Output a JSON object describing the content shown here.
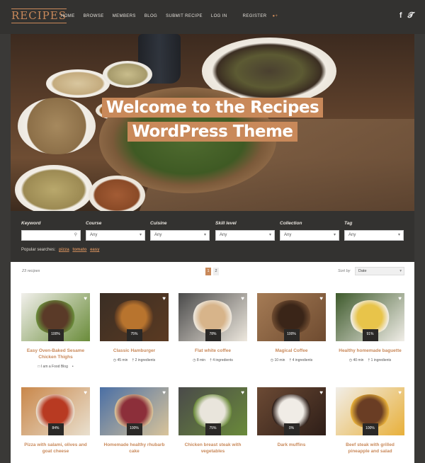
{
  "header": {
    "logo": "RECIPES",
    "nav": [
      "HOME",
      "BROWSE",
      "MEMBERS",
      "BLOG",
      "SUBMIT RECIPE",
      "LOG IN"
    ],
    "register_label": "REGISTER",
    "social": {
      "facebook": "f",
      "twitter": "t"
    }
  },
  "hero": {
    "title_line1": "Welcome to the Recipes",
    "title_line2": "WordPress Theme"
  },
  "search": {
    "fields": [
      {
        "label": "Keyword",
        "value": ""
      },
      {
        "label": "Course",
        "value": "Any"
      },
      {
        "label": "Cuisine",
        "value": "Any"
      },
      {
        "label": "Skill level",
        "value": "Any"
      },
      {
        "label": "Collection",
        "value": "Any"
      },
      {
        "label": "Tag",
        "value": "Any"
      }
    ],
    "popular_label": "Popular searches:",
    "popular": [
      "pizza",
      "tomato",
      "easy"
    ]
  },
  "listing": {
    "count": "23 recipes",
    "pages": [
      "1",
      "2"
    ],
    "sort_label": "Sort by",
    "sort_value": "Date",
    "cards": [
      {
        "title": "Easy Oven-Baked Sesame Chicken Thighs",
        "rating": "100%",
        "meta": [
          "I am a Food Blog"
        ],
        "colors": [
          "#f2f0ec",
          "#5a3a28",
          "#6a8c3a"
        ]
      },
      {
        "title": "Classic Hamburger",
        "rating": "75%",
        "meta": [
          "45 min",
          "2 ingredients"
        ],
        "colors": [
          "#3a2e24",
          "#b8742e",
          "#5b3a22"
        ]
      },
      {
        "title": "Flat white coffee",
        "rating": "78%",
        "meta": [
          "8 min",
          "4 ingredients"
        ],
        "colors": [
          "#4a4a4a",
          "#d7b48a",
          "#eee8de"
        ]
      },
      {
        "title": "Magical Coffee",
        "rating": "100%",
        "meta": [
          "10 min",
          "4 ingredients"
        ],
        "colors": [
          "#a57b55",
          "#3a2518",
          "#6e4b30"
        ]
      },
      {
        "title": "Healthy homemade baguette",
        "rating": "91%",
        "meta": [
          "40 min",
          "1 ingredients"
        ],
        "colors": [
          "#3e5a2c",
          "#e8c44a",
          "#f1eee8"
        ]
      },
      {
        "title": "Pizza with salami, olives and goat cheese",
        "rating": "84%",
        "meta": [],
        "colors": [
          "#c9874a",
          "#b83a22",
          "#e9e0cf"
        ]
      },
      {
        "title": "Homemade healthy rhubarb cake",
        "rating": "100%",
        "meta": [],
        "colors": [
          "#4a6fa5",
          "#8c2f3a",
          "#d9c49a"
        ]
      },
      {
        "title": "Chicken breast steak with vegetables",
        "rating": "75%",
        "meta": [],
        "colors": [
          "#4a4a4a",
          "#e9e5dc",
          "#6a8a3a"
        ]
      },
      {
        "title": "Dark muffins",
        "rating": "0%",
        "meta": [],
        "colors": [
          "#6c4a34",
          "#f0ece6",
          "#2e1e18"
        ]
      },
      {
        "title": "Beef steak with grilled pineapple and salad",
        "rating": "100%",
        "meta": [],
        "colors": [
          "#f1eee8",
          "#6a3d24",
          "#e8b03a"
        ]
      }
    ]
  }
}
